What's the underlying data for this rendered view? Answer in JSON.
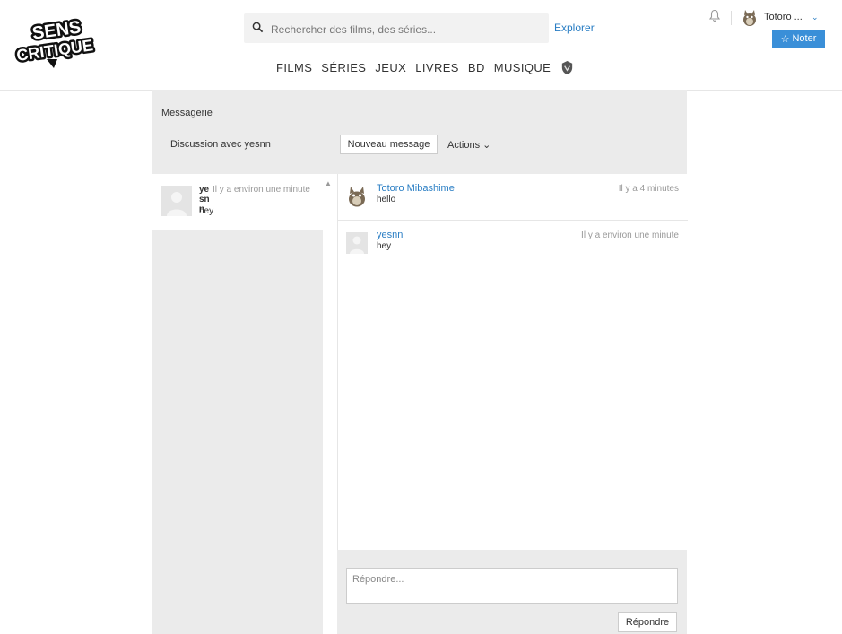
{
  "brand": {
    "line1": "SENS",
    "line2": "CRITIQUE"
  },
  "search": {
    "placeholder": "Rechercher des films, des séries..."
  },
  "header": {
    "explore": "Explorer"
  },
  "nav": {
    "items": [
      "FILMS",
      "SÉRIES",
      "JEUX",
      "LIVRES",
      "BD",
      "MUSIQUE"
    ]
  },
  "user": {
    "name": "Totoro ...",
    "note_button": "Noter"
  },
  "messagerie": {
    "title": "Messagerie",
    "discussion_label": "Discussion avec yesnn",
    "new_message_button": "Nouveau message",
    "actions_label": "Actions"
  },
  "conversations": [
    {
      "name": "yesnn",
      "time": "Il y a environ une minute",
      "preview": "hey"
    }
  ],
  "messages": [
    {
      "author": "Totoro Mibashime",
      "text": "hello",
      "time": "Il y a 4 minutes"
    },
    {
      "author": "yesnn",
      "text": "hey",
      "time": "Il y a environ une minute"
    }
  ],
  "reply": {
    "placeholder": "Répondre...",
    "button": "Répondre"
  },
  "colors": {
    "link": "#2a7ec4",
    "accent_button": "#3a8fd8",
    "panel_bg": "#ebebeb"
  },
  "icons": {
    "search": "search-icon",
    "bell": "bell-icon",
    "note": "star-icon",
    "chevron": "chevron-down-icon"
  }
}
